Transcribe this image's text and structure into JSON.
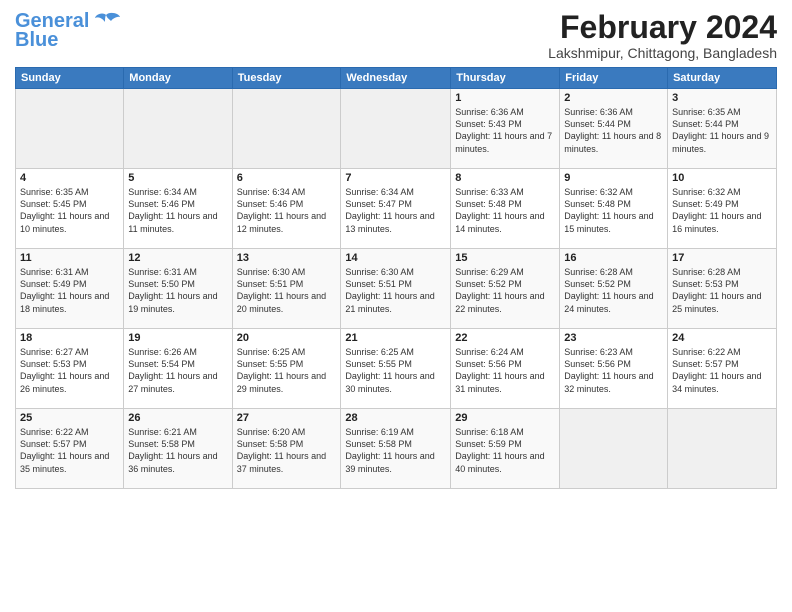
{
  "header": {
    "logo_line1": "General",
    "logo_line2": "Blue",
    "title": "February 2024",
    "subtitle": "Lakshmipur, Chittagong, Bangladesh"
  },
  "days_of_week": [
    "Sunday",
    "Monday",
    "Tuesday",
    "Wednesday",
    "Thursday",
    "Friday",
    "Saturday"
  ],
  "weeks": [
    [
      {
        "num": "",
        "detail": ""
      },
      {
        "num": "",
        "detail": ""
      },
      {
        "num": "",
        "detail": ""
      },
      {
        "num": "",
        "detail": ""
      },
      {
        "num": "1",
        "detail": "Sunrise: 6:36 AM\nSunset: 5:43 PM\nDaylight: 11 hours\nand 7 minutes."
      },
      {
        "num": "2",
        "detail": "Sunrise: 6:36 AM\nSunset: 5:44 PM\nDaylight: 11 hours\nand 8 minutes."
      },
      {
        "num": "3",
        "detail": "Sunrise: 6:35 AM\nSunset: 5:44 PM\nDaylight: 11 hours\nand 9 minutes."
      }
    ],
    [
      {
        "num": "4",
        "detail": "Sunrise: 6:35 AM\nSunset: 5:45 PM\nDaylight: 11 hours\nand 10 minutes."
      },
      {
        "num": "5",
        "detail": "Sunrise: 6:34 AM\nSunset: 5:46 PM\nDaylight: 11 hours\nand 11 minutes."
      },
      {
        "num": "6",
        "detail": "Sunrise: 6:34 AM\nSunset: 5:46 PM\nDaylight: 11 hours\nand 12 minutes."
      },
      {
        "num": "7",
        "detail": "Sunrise: 6:34 AM\nSunset: 5:47 PM\nDaylight: 11 hours\nand 13 minutes."
      },
      {
        "num": "8",
        "detail": "Sunrise: 6:33 AM\nSunset: 5:48 PM\nDaylight: 11 hours\nand 14 minutes."
      },
      {
        "num": "9",
        "detail": "Sunrise: 6:32 AM\nSunset: 5:48 PM\nDaylight: 11 hours\nand 15 minutes."
      },
      {
        "num": "10",
        "detail": "Sunrise: 6:32 AM\nSunset: 5:49 PM\nDaylight: 11 hours\nand 16 minutes."
      }
    ],
    [
      {
        "num": "11",
        "detail": "Sunrise: 6:31 AM\nSunset: 5:49 PM\nDaylight: 11 hours\nand 18 minutes."
      },
      {
        "num": "12",
        "detail": "Sunrise: 6:31 AM\nSunset: 5:50 PM\nDaylight: 11 hours\nand 19 minutes."
      },
      {
        "num": "13",
        "detail": "Sunrise: 6:30 AM\nSunset: 5:51 PM\nDaylight: 11 hours\nand 20 minutes."
      },
      {
        "num": "14",
        "detail": "Sunrise: 6:30 AM\nSunset: 5:51 PM\nDaylight: 11 hours\nand 21 minutes."
      },
      {
        "num": "15",
        "detail": "Sunrise: 6:29 AM\nSunset: 5:52 PM\nDaylight: 11 hours\nand 22 minutes."
      },
      {
        "num": "16",
        "detail": "Sunrise: 6:28 AM\nSunset: 5:52 PM\nDaylight: 11 hours\nand 24 minutes."
      },
      {
        "num": "17",
        "detail": "Sunrise: 6:28 AM\nSunset: 5:53 PM\nDaylight: 11 hours\nand 25 minutes."
      }
    ],
    [
      {
        "num": "18",
        "detail": "Sunrise: 6:27 AM\nSunset: 5:53 PM\nDaylight: 11 hours\nand 26 minutes."
      },
      {
        "num": "19",
        "detail": "Sunrise: 6:26 AM\nSunset: 5:54 PM\nDaylight: 11 hours\nand 27 minutes."
      },
      {
        "num": "20",
        "detail": "Sunrise: 6:25 AM\nSunset: 5:55 PM\nDaylight: 11 hours\nand 29 minutes."
      },
      {
        "num": "21",
        "detail": "Sunrise: 6:25 AM\nSunset: 5:55 PM\nDaylight: 11 hours\nand 30 minutes."
      },
      {
        "num": "22",
        "detail": "Sunrise: 6:24 AM\nSunset: 5:56 PM\nDaylight: 11 hours\nand 31 minutes."
      },
      {
        "num": "23",
        "detail": "Sunrise: 6:23 AM\nSunset: 5:56 PM\nDaylight: 11 hours\nand 32 minutes."
      },
      {
        "num": "24",
        "detail": "Sunrise: 6:22 AM\nSunset: 5:57 PM\nDaylight: 11 hours\nand 34 minutes."
      }
    ],
    [
      {
        "num": "25",
        "detail": "Sunrise: 6:22 AM\nSunset: 5:57 PM\nDaylight: 11 hours\nand 35 minutes."
      },
      {
        "num": "26",
        "detail": "Sunrise: 6:21 AM\nSunset: 5:58 PM\nDaylight: 11 hours\nand 36 minutes."
      },
      {
        "num": "27",
        "detail": "Sunrise: 6:20 AM\nSunset: 5:58 PM\nDaylight: 11 hours\nand 37 minutes."
      },
      {
        "num": "28",
        "detail": "Sunrise: 6:19 AM\nSunset: 5:58 PM\nDaylight: 11 hours\nand 39 minutes."
      },
      {
        "num": "29",
        "detail": "Sunrise: 6:18 AM\nSunset: 5:59 PM\nDaylight: 11 hours\nand 40 minutes."
      },
      {
        "num": "",
        "detail": ""
      },
      {
        "num": "",
        "detail": ""
      }
    ]
  ]
}
